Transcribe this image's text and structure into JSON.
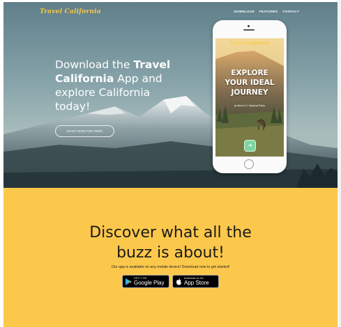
{
  "header": {
    "brand": "Travel California",
    "nav": [
      "DOWNLOAD",
      "FEATURES",
      "CONTACT"
    ]
  },
  "hero": {
    "headline_pre": "Download the ",
    "headline_bold": "Travel California",
    "headline_post": " App and explore California today!",
    "cta": "START NOW FOR FREE!"
  },
  "phone": {
    "app_brand": "Travel California",
    "title_line1": "EXPLORE",
    "title_line2": "YOUR IDEAL",
    "title_line3": "JOURNEY",
    "subtitle": "by Best U.S. National Parks",
    "go_icon": "arrow-right-icon"
  },
  "promo": {
    "heading_line1": "Discover what all the",
    "heading_line2": "buzz is about!",
    "lead": "Our app is available on any mobile device! Download now to get started!",
    "google_small": "GET IT ON",
    "google_big": "Google Play",
    "apple_small": "Download on the",
    "apple_big": "App Store"
  },
  "colors": {
    "accent_yellow": "#fcc84b",
    "brand_yellow": "#f7c948",
    "app_button_green": "#7fd4a2"
  }
}
